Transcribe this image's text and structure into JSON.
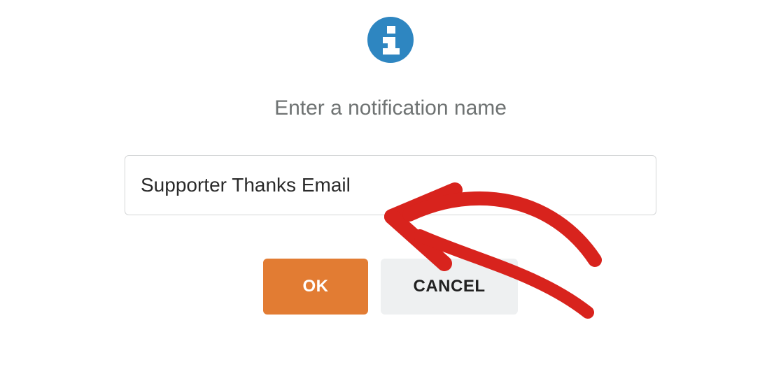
{
  "dialog": {
    "prompt": "Enter a notification name",
    "input_value": "Supporter Thanks Email",
    "ok_label": "OK",
    "cancel_label": "CANCEL"
  },
  "colors": {
    "info_icon_bg": "#2e86c1",
    "ok_bg": "#e27c33",
    "cancel_bg": "#eef0f1",
    "annotation": "#d8231d"
  }
}
